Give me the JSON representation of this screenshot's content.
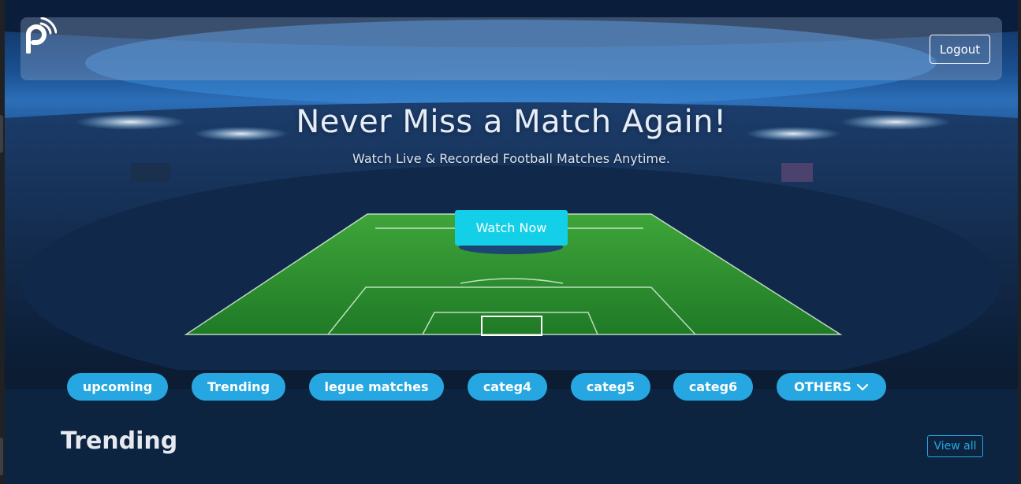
{
  "navbar": {
    "logo_icon": "podcast-p-logo-icon",
    "logout_label": "Logout"
  },
  "hero": {
    "title": "Never Miss a Match Again!",
    "subtitle": "Watch Live & Recorded Football Matches Anytime.",
    "cta_label": "Watch Now",
    "background_icon": "stadium-image"
  },
  "categories": [
    {
      "label": "upcoming"
    },
    {
      "label": "Trending"
    },
    {
      "label": "legue matches"
    },
    {
      "label": "categ4"
    },
    {
      "label": "categ5"
    },
    {
      "label": "categ6"
    },
    {
      "label": "OTHERS",
      "icon": "chevron-down-icon"
    }
  ],
  "section": {
    "title": "Trending",
    "view_all_label": "View all"
  },
  "colors": {
    "accent": "#27a7e1",
    "cta": "#13d0e8",
    "page_bg": "#0c2440"
  }
}
